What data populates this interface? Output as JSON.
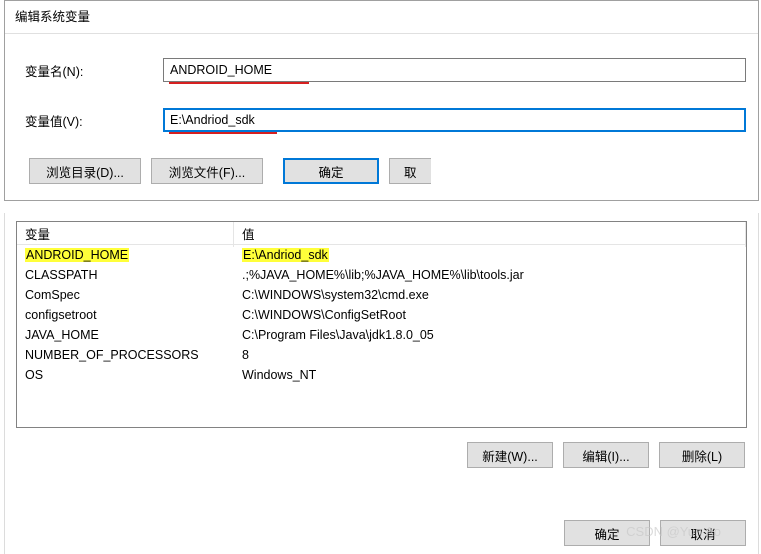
{
  "edit_dialog": {
    "title": "编辑系统变量",
    "name_label": "变量名(N):",
    "name_value": "ANDROID_HOME",
    "value_label": "变量值(V):",
    "value_value": "E:\\Andriod_sdk",
    "browse_dir": "浏览目录(D)...",
    "browse_file": "浏览文件(F)...",
    "ok": "确定",
    "cancel_partial": "取"
  },
  "table": {
    "header_var": "变量",
    "header_val": "值",
    "rows": [
      {
        "var": "ANDROID_HOME",
        "val": "E:\\Andriod_sdk",
        "highlight": true
      },
      {
        "var": "CLASSPATH",
        "val": ".;%JAVA_HOME%\\lib;%JAVA_HOME%\\lib\\tools.jar"
      },
      {
        "var": "ComSpec",
        "val": "C:\\WINDOWS\\system32\\cmd.exe"
      },
      {
        "var": "configsetroot",
        "val": "C:\\WINDOWS\\ConfigSetRoot"
      },
      {
        "var": "JAVA_HOME",
        "val": "C:\\Program Files\\Java\\jdk1.8.0_05"
      },
      {
        "var": "NUMBER_OF_PROCESSORS",
        "val": "8"
      },
      {
        "var": "OS",
        "val": "Windows_NT"
      }
    ]
  },
  "lower_buttons": {
    "new": "新建(W)...",
    "edit": "编辑(I)...",
    "delete": "删除(L)"
  },
  "footer": {
    "ok": "确定",
    "cancel": "取消"
  },
  "watermark": "CSDN @Yun Ao"
}
